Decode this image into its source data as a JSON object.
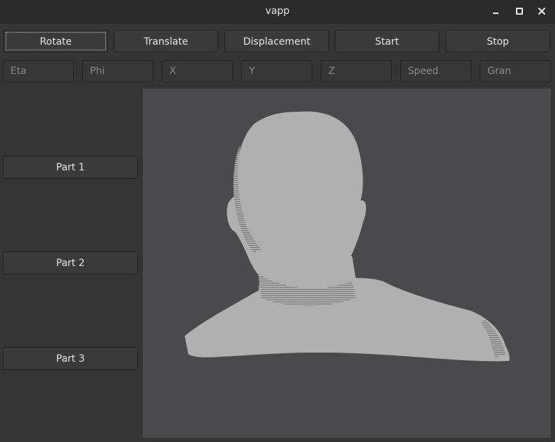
{
  "window": {
    "title": "vapp"
  },
  "toolbar": {
    "rotate_label": "Rotate",
    "translate_label": "Translate",
    "displacement_label": "Displacement",
    "start_label": "Start",
    "stop_label": "Stop"
  },
  "params": {
    "eta_placeholder": "Eta",
    "phi_placeholder": "Phi",
    "x_placeholder": "X",
    "y_placeholder": "Y",
    "z_placeholder": "Z",
    "speed_placeholder": "Speed",
    "gran_placeholder": "Gran"
  },
  "sidebar": {
    "items": [
      {
        "label": "Part 1"
      },
      {
        "label": "Part 2"
      },
      {
        "label": "Part 3"
      }
    ]
  },
  "viewport": {
    "background": "#4a4a4c",
    "model_color": "#b0b0b0",
    "model_shadow_color": "#2a2a2a"
  },
  "icons": {
    "minimize": "minimize-icon",
    "maximize": "maximize-icon",
    "close": "close-icon"
  }
}
